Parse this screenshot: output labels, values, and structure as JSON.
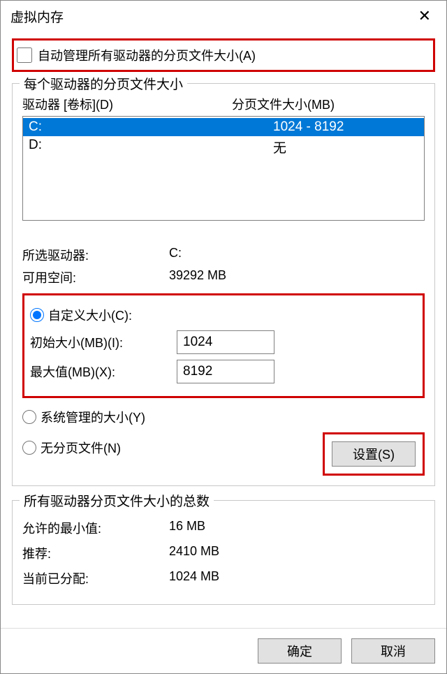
{
  "window": {
    "title": "虚拟内存"
  },
  "autoManage": {
    "label": "自动管理所有驱动器的分页文件大小(A)"
  },
  "perDrive": {
    "groupTitle": "每个驱动器的分页文件大小",
    "colDrive": "驱动器 [卷标](D)",
    "colPageSize": "分页文件大小(MB)",
    "drives": [
      {
        "letter": "C:",
        "size": "1024 - 8192",
        "selected": true
      },
      {
        "letter": "D:",
        "size": "无",
        "selected": false
      }
    ],
    "selectedDriveLabel": "所选驱动器:",
    "selectedDriveValue": "C:",
    "freeSpaceLabel": "可用空间:",
    "freeSpaceValue": "39292 MB",
    "customRadio": "自定义大小(C):",
    "initialLabel": "初始大小(MB)(I):",
    "initialValue": "1024",
    "maxLabel": "最大值(MB)(X):",
    "maxValue": "8192",
    "systemRadio": "系统管理的大小(Y)",
    "noPageRadio": "无分页文件(N)",
    "setButton": "设置(S)"
  },
  "totals": {
    "groupTitle": "所有驱动器分页文件大小的总数",
    "minLabel": "允许的最小值:",
    "minValue": "16 MB",
    "recLabel": "推荐:",
    "recValue": "2410 MB",
    "curLabel": "当前已分配:",
    "curValue": "1024 MB"
  },
  "buttons": {
    "ok": "确定",
    "cancel": "取消"
  }
}
